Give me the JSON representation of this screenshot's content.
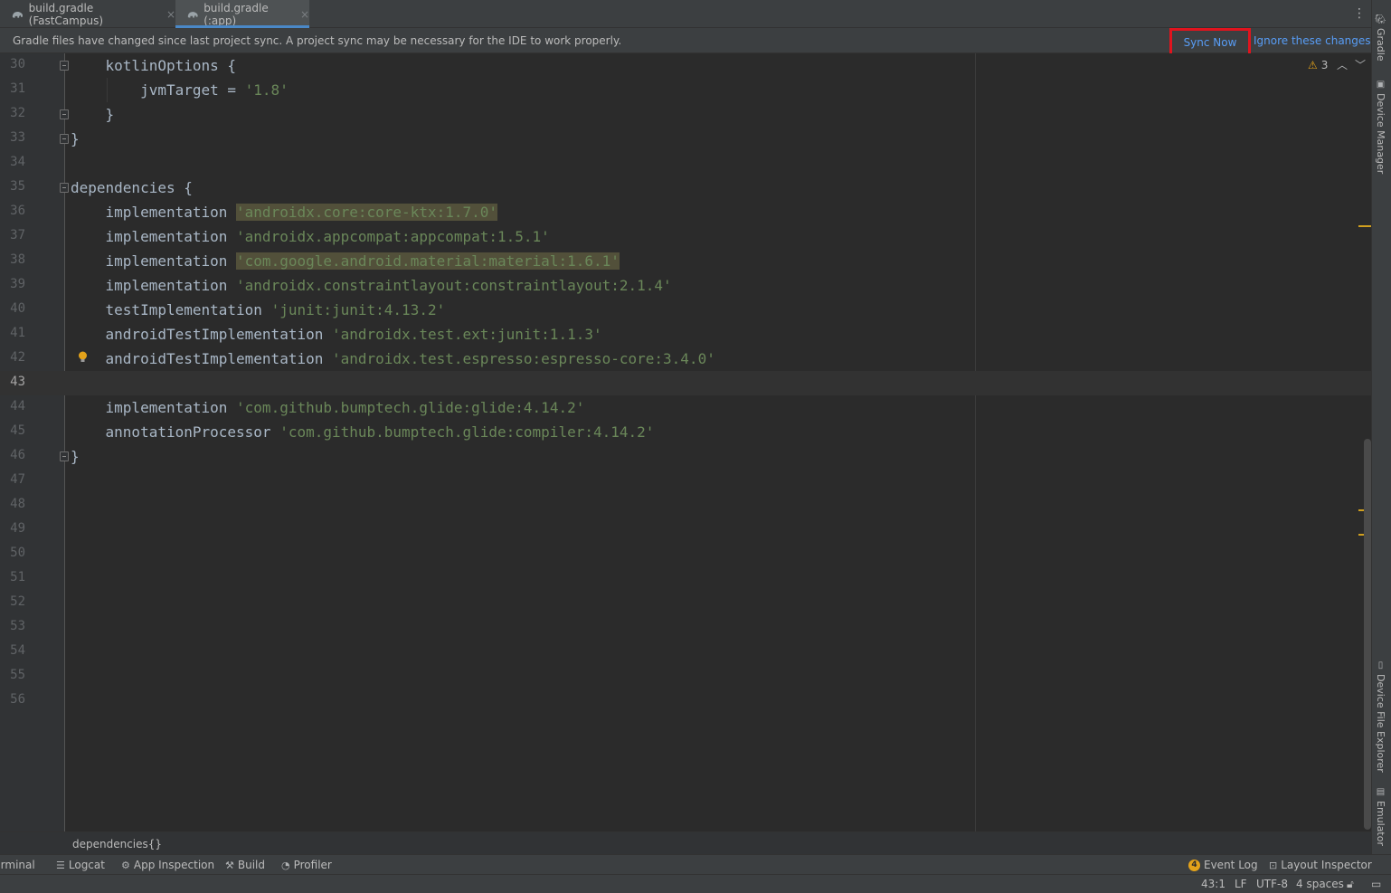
{
  "tabs": [
    {
      "label": "build.gradle (FastCampus)",
      "close": "×"
    },
    {
      "label": "build.gradle (:app)",
      "close": "×"
    }
  ],
  "tabs_menu": "⋮",
  "notification": {
    "message": "Gradle files have changed since last project sync. A project sync may be necessary for the IDE to work properly.",
    "sync_now": "Sync Now",
    "ignore": "Ignore these changes"
  },
  "editor": {
    "warning_count": "3",
    "lines": [
      {
        "n": "30",
        "code": "    kotlinOptions {"
      },
      {
        "n": "31",
        "code": "        jvmTarget = ",
        "str": "'1.8'"
      },
      {
        "n": "32",
        "code": "    }"
      },
      {
        "n": "33",
        "code": "}"
      },
      {
        "n": "34",
        "code": ""
      },
      {
        "n": "35",
        "code": "dependencies {"
      },
      {
        "n": "36",
        "code": "    implementation ",
        "str": "'androidx.core:core-ktx:1.7.0'"
      },
      {
        "n": "37",
        "code": "    implementation ",
        "str": "'androidx.appcompat:appcompat:1.5.1'"
      },
      {
        "n": "38",
        "code": "    implementation ",
        "str": "'com.google.android.material:material:1.6.1'"
      },
      {
        "n": "39",
        "code": "    implementation ",
        "str": "'androidx.constraintlayout:constraintlayout:2.1.4'"
      },
      {
        "n": "40",
        "code": "    testImplementation ",
        "str": "'junit:junit:4.13.2'"
      },
      {
        "n": "41",
        "code": "    androidTestImplementation ",
        "str": "'androidx.test.ext:junit:1.1.3'"
      },
      {
        "n": "42",
        "code": "    androidTestImplementation ",
        "str": "'androidx.test.espresso:espresso-core:3.4.0'"
      },
      {
        "n": "43",
        "code": ""
      },
      {
        "n": "44",
        "code": "    implementation ",
        "str": "'com.github.bumptech.glide:glide:4.14.2'"
      },
      {
        "n": "45",
        "code": "    annotationProcessor ",
        "str": "'com.github.bumptech.glide:compiler:4.14.2'"
      },
      {
        "n": "46",
        "code": "}"
      },
      {
        "n": "47",
        "code": ""
      },
      {
        "n": "48",
        "code": ""
      },
      {
        "n": "49",
        "code": ""
      },
      {
        "n": "50",
        "code": ""
      },
      {
        "n": "51",
        "code": ""
      },
      {
        "n": "52",
        "code": ""
      },
      {
        "n": "53",
        "code": ""
      },
      {
        "n": "54",
        "code": ""
      },
      {
        "n": "55",
        "code": ""
      },
      {
        "n": "56",
        "code": ""
      }
    ],
    "current_line": "43"
  },
  "breadcrumb": "dependencies{}",
  "tool_windows": {
    "terminal": "Terminal",
    "logcat": "Logcat",
    "app_inspection": "App Inspection",
    "build": "Build",
    "profiler": "Profiler",
    "event_log_badge": "4",
    "event_log": "Event Log",
    "layout_inspector": "Layout Inspector"
  },
  "status": {
    "position": "43:1",
    "line_sep": "LF",
    "encoding": "UTF-8",
    "indent": "4 spaces"
  },
  "right_stripe": {
    "gradle": "Gradle",
    "device_manager": "Device Manager",
    "device_file_explorer": "Device File Explorer",
    "emulator": "Emulator"
  },
  "colors": {
    "accent": "#4a88c7",
    "link": "#589df6",
    "highlight_box": "#e0141e",
    "string": "#6a8759",
    "warning": "#e3a21a"
  }
}
